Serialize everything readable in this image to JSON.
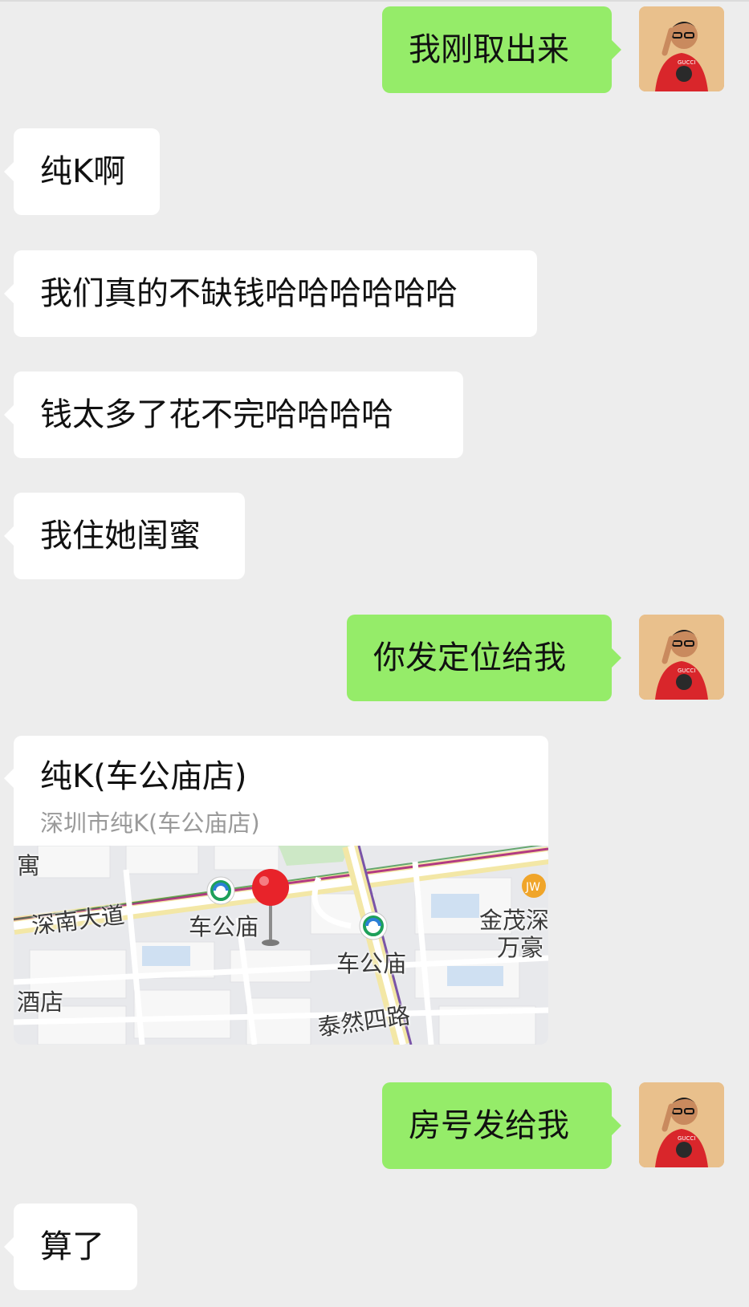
{
  "messages": [
    {
      "side": "right",
      "text": "我刚取出来"
    },
    {
      "side": "left",
      "text": "纯K啊"
    },
    {
      "side": "left",
      "text": "我们真的不缺钱哈哈哈哈哈哈"
    },
    {
      "side": "left",
      "text": "钱太多了花不完哈哈哈哈"
    },
    {
      "side": "left",
      "text": "我住她闺蜜"
    },
    {
      "side": "right",
      "text": "你发定位给我"
    },
    {
      "side": "right",
      "text": "房号发给我"
    },
    {
      "side": "left",
      "text": "算了"
    }
  ],
  "location": {
    "title": "纯K(车公庙店)",
    "address": "深圳市纯K(车公庙店)",
    "map_labels": {
      "road_shennan": "深南大道",
      "station_1": "车公庙",
      "station_2": "车公庙",
      "jinmao": "金茂深",
      "wanhao": "万豪",
      "hotel": "酒店",
      "taoran": "泰然四路",
      "apartment": "寓"
    }
  },
  "colors": {
    "background": "#ededed",
    "bubble_self": "#95ec69",
    "bubble_other": "#ffffff",
    "pin": "#e8232a"
  },
  "avatar": {
    "icon": "user-avatar-icon"
  }
}
